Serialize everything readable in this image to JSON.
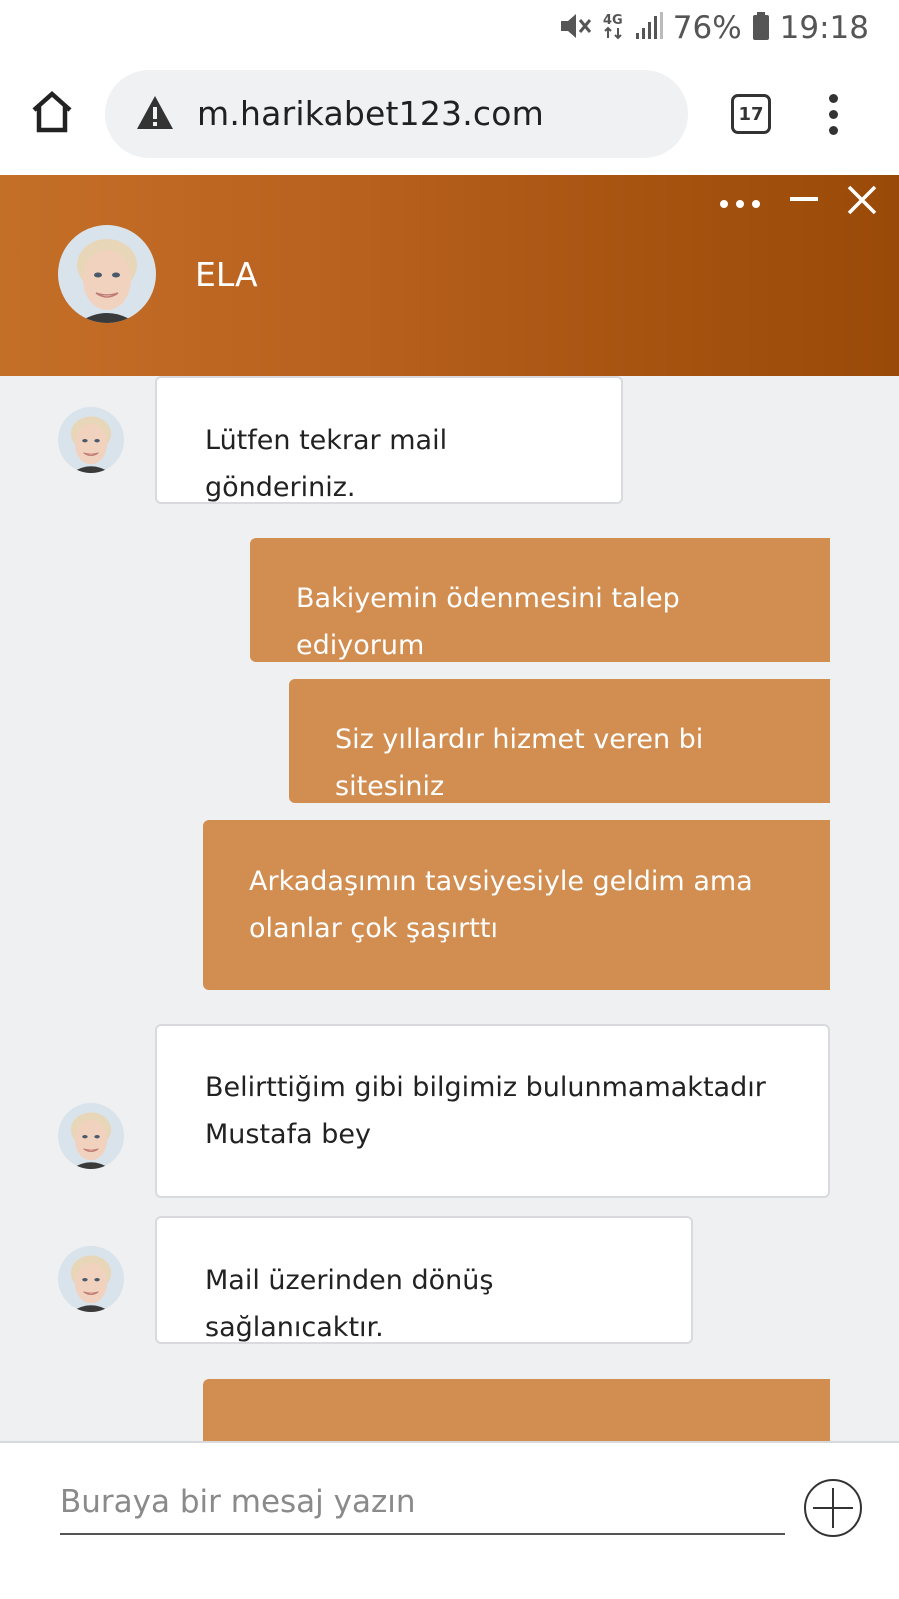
{
  "status_bar": {
    "battery": "76%",
    "time": "19:18",
    "network": "4G",
    "icons": [
      "mute-icon",
      "network-4g-icon",
      "signal-icon",
      "battery-icon"
    ]
  },
  "browser": {
    "url": "m.harikabet123.com",
    "tab_count": "17",
    "icons": [
      "home-icon",
      "warning-icon",
      "tabs-icon",
      "menu-icon"
    ]
  },
  "chat": {
    "agent_name": "ELA",
    "header_colors": [
      "#c46f28",
      "#9a4a08"
    ],
    "user_bubble_color": "#d28d51",
    "messages": [
      {
        "sender": "agent",
        "text": "Lütfen tekrar mail gönderiniz."
      },
      {
        "sender": "user",
        "text": "Bakiyemin ödenmesini talep ediyorum"
      },
      {
        "sender": "user",
        "text": "Siz yıllardır hizmet veren bi sitesiniz"
      },
      {
        "sender": "user",
        "lines": [
          "Arkadaşımın tavsiyesiyle geldim ama",
          "olanlar çok şaşırttı"
        ]
      },
      {
        "sender": "agent",
        "lines": [
          "Belirttiğim gibi bilgimiz bulunmamaktadır",
          "Mustafa bey"
        ]
      },
      {
        "sender": "agent",
        "text": "Mail üzerinden dönüş sağlanıcaktır."
      },
      {
        "sender": "user",
        "text": ""
      }
    ],
    "input": {
      "placeholder": "Buraya bir mesaj yazın",
      "value": ""
    }
  }
}
